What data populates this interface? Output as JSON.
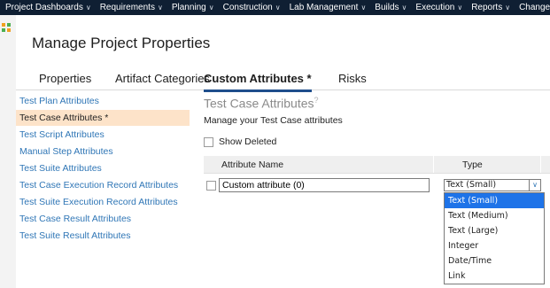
{
  "topnav": {
    "items": [
      {
        "label": "Project Dashboards",
        "chev": "∨"
      },
      {
        "label": "Requirements",
        "chev": "∨"
      },
      {
        "label": "Planning",
        "chev": "∨"
      },
      {
        "label": "Construction",
        "chev": "∨"
      },
      {
        "label": "Lab Management",
        "chev": "∨"
      },
      {
        "label": "Builds",
        "chev": "∨"
      },
      {
        "label": "Execution",
        "chev": "∨"
      },
      {
        "label": "Reports",
        "chev": "∨"
      },
      {
        "label": "Change Request",
        "chev": ""
      }
    ]
  },
  "page": {
    "title": "Manage Project Properties"
  },
  "tabs": [
    {
      "label": "Properties"
    },
    {
      "label": "Artifact Categories"
    },
    {
      "label": "Custom Attributes *"
    },
    {
      "label": "Risks"
    }
  ],
  "sidebar": {
    "items": [
      {
        "label": "Test Plan Attributes"
      },
      {
        "label": "Test Case Attributes *"
      },
      {
        "label": "Test Script Attributes"
      },
      {
        "label": "Manual Step Attributes"
      },
      {
        "label": "Test Suite Attributes"
      },
      {
        "label": "Test Case Execution Record Attributes"
      },
      {
        "label": "Test Suite Execution Record Attributes"
      },
      {
        "label": "Test Case Result Attributes"
      },
      {
        "label": "Test Suite Result Attributes"
      }
    ]
  },
  "section": {
    "title": "Test Case Attributes",
    "help": "?",
    "description": "Manage your Test Case attributes",
    "show_deleted_label": "Show Deleted"
  },
  "table": {
    "headers": {
      "name": "Attribute Name",
      "type": "Type"
    },
    "row": {
      "name_value": "Custom attribute (0)",
      "type_value": "Text (Small)"
    }
  },
  "dropdown": {
    "options": [
      "Text (Small)",
      "Text (Medium)",
      "Text (Large)",
      "Integer",
      "Date/Time",
      "Link"
    ],
    "selected_index": 0
  },
  "colors": {
    "nav_bg": "#0f1f33",
    "link": "#2f76b6",
    "active_sidebar_bg": "#fde3c9",
    "dropdown_selected": "#1e73e8",
    "tab_underline": "#1f4e8c"
  },
  "icons": {
    "grid": "grid-icon",
    "help": "help-icon",
    "dropdown_arrow": "chevron-down-icon"
  }
}
